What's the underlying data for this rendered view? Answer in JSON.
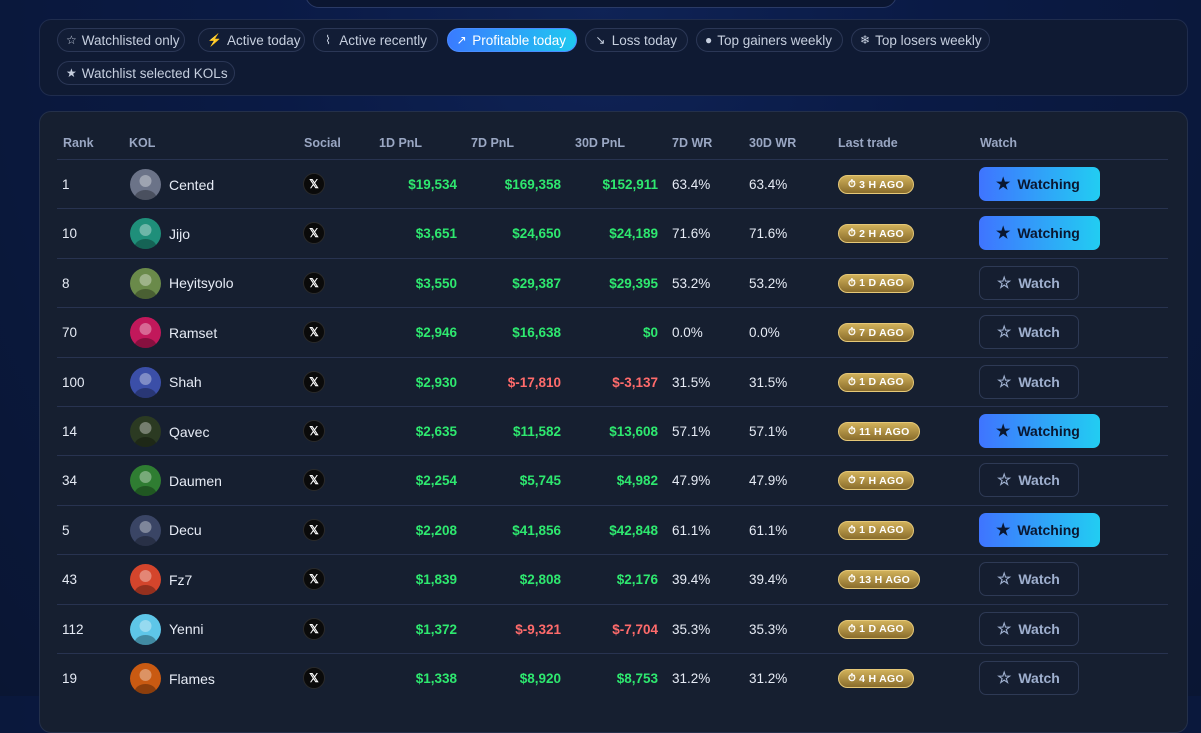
{
  "filters": [
    {
      "label": "Watchlisted only",
      "icon": "star-outline-icon",
      "glyph": "☆",
      "active": false
    },
    {
      "label": "Active today",
      "icon": "bolt-icon",
      "glyph": "⚡",
      "active": false
    },
    {
      "label": "Active recently",
      "icon": "pulse-icon",
      "glyph": "⌇",
      "active": false
    },
    {
      "label": "Profitable today",
      "icon": "trending-up-icon",
      "glyph": "↗",
      "active": true
    },
    {
      "label": "Loss today",
      "icon": "trending-down-icon",
      "glyph": "↘",
      "active": false
    },
    {
      "label": "Top gainers weekly",
      "icon": "flame-icon",
      "glyph": "●",
      "active": false
    },
    {
      "label": "Top losers weekly",
      "icon": "snowflake-icon",
      "glyph": "❄",
      "active": false
    },
    {
      "label": "Watchlist selected KOLs",
      "icon": "star-filled-icon",
      "glyph": "★",
      "active": false
    }
  ],
  "table": {
    "headers": {
      "rank": "Rank",
      "kol": "KOL",
      "social": "Social",
      "pnl1d": "1D PnL",
      "pnl7d": "7D PnL",
      "pnl30d": "30D PnL",
      "wr7d": "7D WR",
      "wr30d": "30D WR",
      "last_trade": "Last trade",
      "watch": "Watch"
    },
    "social_glyph": "𝕏",
    "watching_label": "Watching",
    "watch_label": "Watch",
    "rows": [
      {
        "rank": "1",
        "name": "Cented",
        "pnl1d": "$19,534",
        "pnl7d": "$169,358",
        "pnl30d": "$152,911",
        "wr7d": "63.4%",
        "wr30d": "63.4%",
        "last": "3 H AGO",
        "watching": true,
        "avatar": "#6b7388"
      },
      {
        "rank": "10",
        "name": "Jijo",
        "pnl1d": "$3,651",
        "pnl7d": "$24,650",
        "pnl30d": "$24,189",
        "wr7d": "71.6%",
        "wr30d": "71.6%",
        "last": "2 H AGO",
        "watching": true,
        "avatar": "#1f8f7a"
      },
      {
        "rank": "8",
        "name": "Heyitsyolo",
        "pnl1d": "$3,550",
        "pnl7d": "$29,387",
        "pnl30d": "$29,395",
        "wr7d": "53.2%",
        "wr30d": "53.2%",
        "last": "1 D AGO",
        "watching": false,
        "avatar": "#6a8a4a"
      },
      {
        "rank": "70",
        "name": "Ramset",
        "pnl1d": "$2,946",
        "pnl7d": "$16,638",
        "pnl30d": "$0",
        "wr7d": "0.0%",
        "wr30d": "0.0%",
        "last": "7 D AGO",
        "watching": false,
        "avatar": "#c2185b"
      },
      {
        "rank": "100",
        "name": "Shah",
        "pnl1d": "$2,930",
        "pnl7d": "$-17,810",
        "pnl30d": "$-3,137",
        "wr7d": "31.5%",
        "wr30d": "31.5%",
        "last": "1 D AGO",
        "watching": false,
        "avatar": "#3b4fa8"
      },
      {
        "rank": "14",
        "name": "Qavec",
        "pnl1d": "$2,635",
        "pnl7d": "$11,582",
        "pnl30d": "$13,608",
        "wr7d": "57.1%",
        "wr30d": "57.1%",
        "last": "11 H AGO",
        "watching": true,
        "avatar": "#2b3a22"
      },
      {
        "rank": "34",
        "name": "Daumen",
        "pnl1d": "$2,254",
        "pnl7d": "$5,745",
        "pnl30d": "$4,982",
        "wr7d": "47.9%",
        "wr30d": "47.9%",
        "last": "7 H AGO",
        "watching": false,
        "avatar": "#2f7d32"
      },
      {
        "rank": "5",
        "name": "Decu",
        "pnl1d": "$2,208",
        "pnl7d": "$41,856",
        "pnl30d": "$42,848",
        "wr7d": "61.1%",
        "wr30d": "61.1%",
        "last": "1 D AGO",
        "watching": true,
        "avatar": "#3a4565"
      },
      {
        "rank": "43",
        "name": "Fz7",
        "pnl1d": "$1,839",
        "pnl7d": "$2,808",
        "pnl30d": "$2,176",
        "wr7d": "39.4%",
        "wr30d": "39.4%",
        "last": "13 H AGO",
        "watching": false,
        "avatar": "#d4452c"
      },
      {
        "rank": "112",
        "name": "Yenni",
        "pnl1d": "$1,372",
        "pnl7d": "$-9,321",
        "pnl30d": "$-7,704",
        "wr7d": "35.3%",
        "wr30d": "35.3%",
        "last": "1 D AGO",
        "watching": false,
        "avatar": "#5ec6e8"
      },
      {
        "rank": "19",
        "name": "Flames",
        "pnl1d": "$1,338",
        "pnl7d": "$8,920",
        "pnl30d": "$8,753",
        "wr7d": "31.2%",
        "wr30d": "31.2%",
        "last": "4 H AGO",
        "watching": false,
        "avatar": "#c95a12"
      }
    ]
  }
}
